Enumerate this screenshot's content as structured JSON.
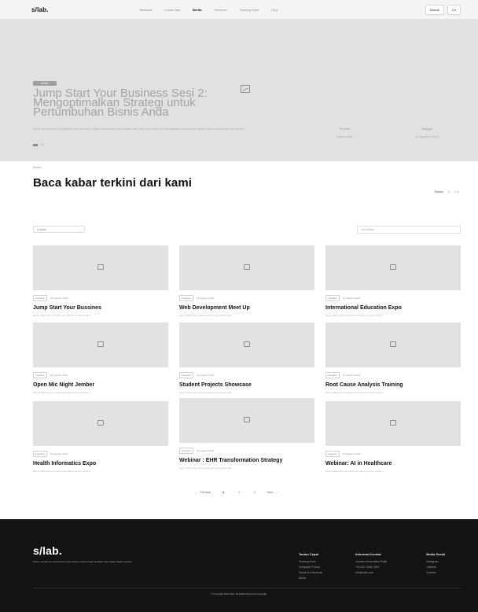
{
  "nav": {
    "logo": "s/lab.",
    "items": [
      "Beranda",
      "Lokasi Jual",
      "Berita",
      "Pameran",
      "Tentang Kami",
      "FAQ"
    ],
    "right_buttons": [
      "Masuk",
      "Ce"
    ]
  },
  "hero": {
    "badge": "Event",
    "title": "Jump Start Your Business Sesi 2: Mengoptimalkan Strategi untuk Pertumbuhan Bisnis Anda",
    "description": "Bisnis menjadi lebih menjanjikan dan ekosistem digital menawarkan kesempatan baru bagi kamu untuk mengembangkan usaha kamu secara lebih berkelanjutan dan terukur.",
    "progress_text": "1/3",
    "meta": [
      {
        "label": "Penulis",
        "value": "Admin Slab"
      },
      {
        "label": "Tanggal",
        "value": "19 Agustus 2024"
      }
    ]
  },
  "section": {
    "crumb": "Berita",
    "title": "Baca kabar terkini dari kami",
    "sort": {
      "label": "Terbaru",
      "options": [
        "A",
        "Z-A"
      ]
    },
    "filter_select": "Urutkan",
    "search_placeholder": "Cari Berita"
  },
  "cards": [
    {
      "tag": "Kegiatan",
      "date": "19 Agustus 2024",
      "title": "Jump Start Your Bussines",
      "excerpt": "Bisnis offlike dari membaca dan bekerja sama meraih s..."
    },
    {
      "tag": "Kegiatan",
      "date": "19 Agustus 2024",
      "title": "Web Development Meet Up",
      "excerpt": "Event offline dan meliputi kemampuan desain dan..."
    },
    {
      "tag": "Kegiatan",
      "date": "19 Agustus 2024",
      "title": "International Education Expo",
      "excerpt": "Bisnis offlike dari membaca dan bekerja sama meraih s..."
    },
    {
      "tag": "Kegiatan",
      "date": "19 Agustus 2024",
      "title": "Open Mic Night Jember",
      "excerpt": "Bisnis offlike dari membaca dan bekerja sama meraih s..."
    },
    {
      "tag": "Kegiatan",
      "date": "19 Agustus 2024",
      "title": "Student Projects Showcase",
      "excerpt": "Event offline dan meliputi kemampuan desain dan..."
    },
    {
      "tag": "Kegiatan",
      "date": "19 Agustus 2024",
      "title": "Root Cause Analysis Training",
      "excerpt": "Bisnis offlike dari membaca dan bekerja sama meraih s..."
    },
    {
      "tag": "Kegiatan",
      "date": "19 Agustus 2024",
      "title": "Health Informatics Expo",
      "excerpt": "Bisnis offlike dari membaca dan bekerja sama meraih s..."
    },
    {
      "tag": "Kegiatan",
      "date": "19 Agustus 2024",
      "title": "Webinar : EHR Transformation Strategy",
      "excerpt": "Event offline dan meliputi kemampuan desain dan..."
    },
    {
      "tag": "Kegiatan",
      "date": "19 Agustus 2024",
      "title": "Webinar: AI in Healthcare",
      "excerpt": "Bisnis offlike dari membaca dan bekerja sama meraih s..."
    }
  ],
  "pagination": {
    "prev": "Previous",
    "pages": [
      "1",
      "2",
      "3"
    ],
    "active": "1",
    "next": "Next"
  },
  "footer": {
    "logo": "s/lab.",
    "description": "Solusi manajemen administrasi yang efisien untuk jurusan keahlian Informatika bagian Jember.",
    "columns": [
      {
        "head": "Tautan Cepat",
        "links": [
          "Tentang Kami",
          "Kebijakan Privasi",
          "Syarat & Ketentuan",
          "Berita"
        ]
      },
      {
        "head": "Informasi Kontak",
        "links": [
          "Jurusan Informatika Polije",
          "+62 812 3456 7890",
          "info@slab.com"
        ]
      },
      {
        "head": "Media Sosial",
        "links": [
          "Instagram",
          "LinkedIn",
          "Youtube"
        ]
      }
    ],
    "copyright": "© Copyright 2024 Slab. All Rights Reserved copyright."
  }
}
